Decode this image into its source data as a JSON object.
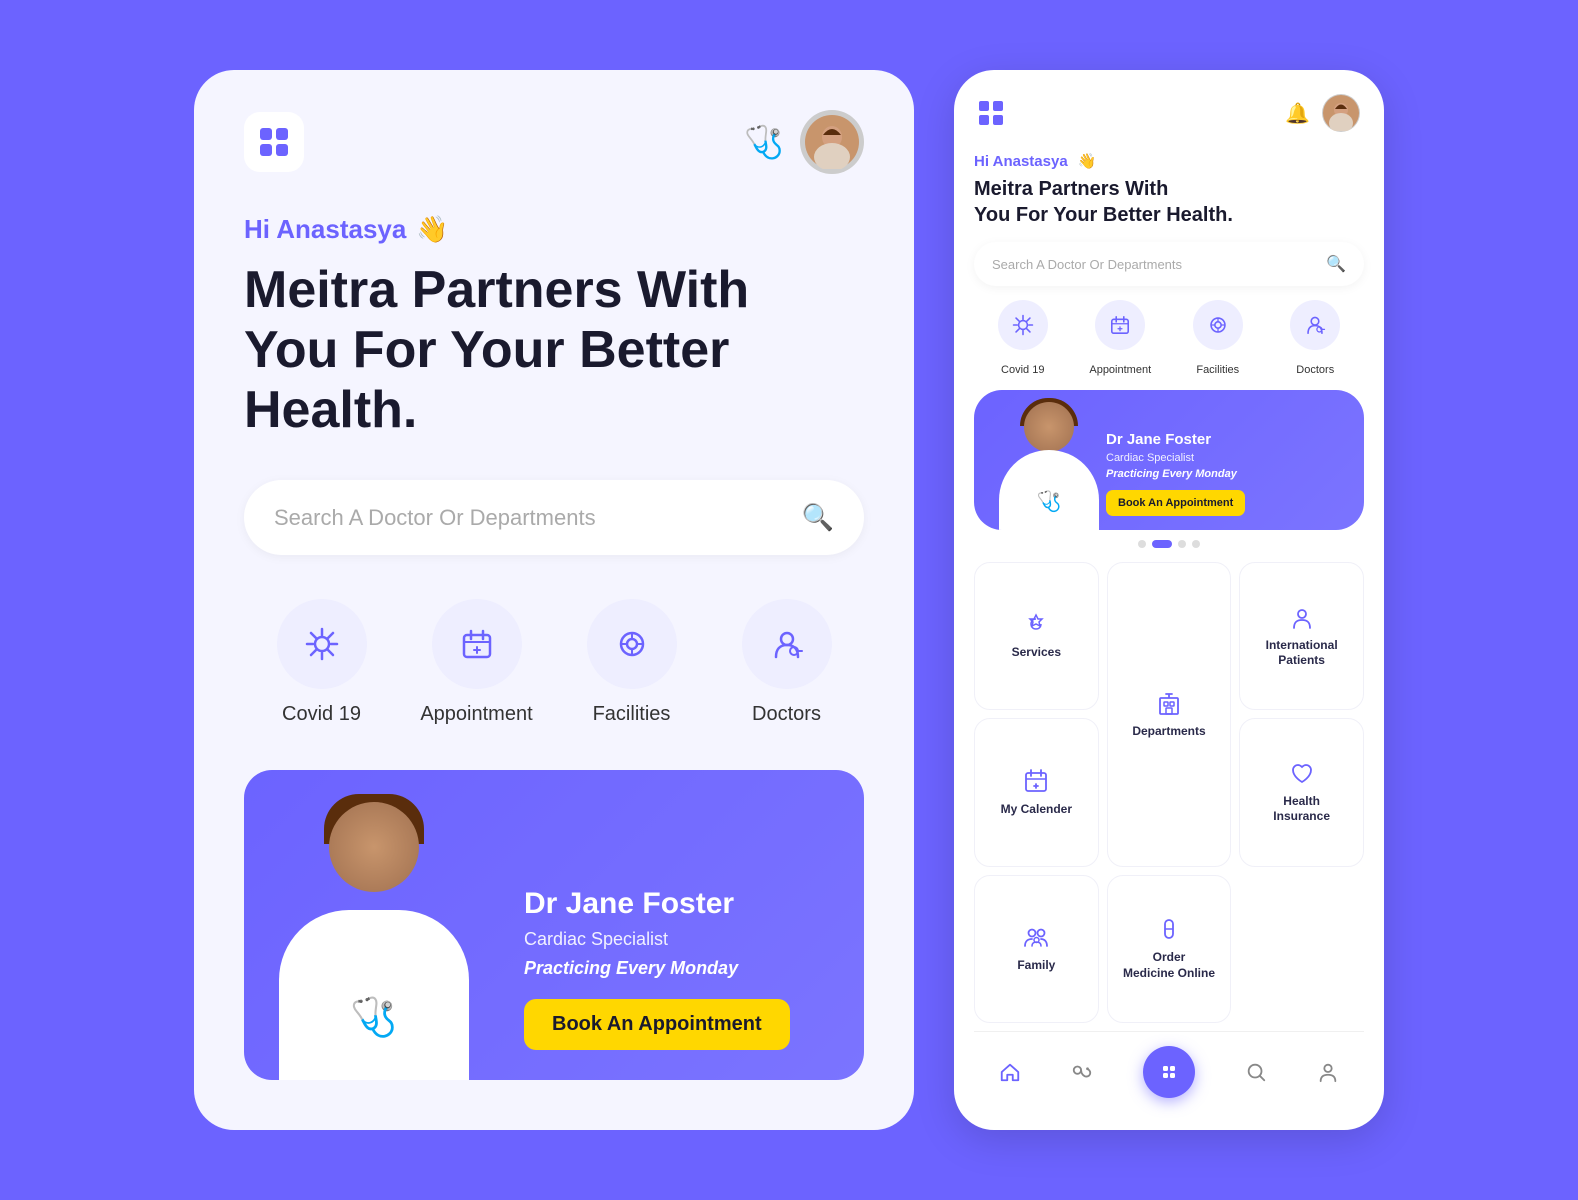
{
  "left_phone": {
    "greeting": "Hi Anastasya",
    "greeting_emoji": "👋",
    "hero_title": "Meitra Partners With\nYou For Your Better Health.",
    "search_placeholder": "Search A  Doctor Or Departments",
    "categories": [
      {
        "icon": "⚙️",
        "label": "Covid 19"
      },
      {
        "icon": "📋",
        "label": "Appointment"
      },
      {
        "icon": "🎯",
        "label": "Facilities"
      },
      {
        "icon": "🩺",
        "label": "Doctors"
      }
    ],
    "banner": {
      "doctor_name": "Dr Jane Foster",
      "specialty": "Cardiac Specialist",
      "schedule": "Practicing Every Monday",
      "book_btn": "Book An Appointment"
    }
  },
  "right_phone": {
    "greeting": "Hi Anastasya",
    "greeting_emoji": "👋",
    "hero_title": "Meitra Partners With\nYou For Your Better Health.",
    "search_placeholder": "Search A  Doctor Or Departments",
    "categories": [
      {
        "icon": "⚙️",
        "label": "Covid 19"
      },
      {
        "icon": "📋",
        "label": "Appointment"
      },
      {
        "icon": "🎯",
        "label": "Facilities"
      },
      {
        "icon": "🩺",
        "label": "Doctors"
      }
    ],
    "banner": {
      "doctor_name": "Dr Jane Foster",
      "specialty": "Cardiac Specialist",
      "schedule": "Practicing Every Monday",
      "book_btn": "Book An Appointment"
    },
    "services": [
      {
        "icon": "❤️",
        "label": "Services"
      },
      {
        "icon": "🏢",
        "label": "Departments"
      },
      {
        "icon": "👤",
        "label": "International\nPatients"
      },
      {
        "icon": "📅",
        "label": "My Calender"
      },
      {
        "icon": "❤️‍🩹",
        "label": "Health\nInsurance"
      },
      {
        "icon": "👨‍👩‍👧",
        "label": "Family"
      },
      {
        "icon": "💊",
        "label": "Order\nMedicine Online"
      }
    ],
    "nav": [
      {
        "icon": "🏠",
        "active": true
      },
      {
        "icon": "🩺",
        "active": false
      },
      {
        "icon": "🔍",
        "active": false
      },
      {
        "icon": "👤",
        "active": false
      }
    ]
  },
  "colors": {
    "primary": "#6C63FF",
    "accent": "#FFD700",
    "background": "#6C63FF",
    "card_bg": "#F5F5FF",
    "text_dark": "#1a1a2e",
    "text_light": "#888888"
  }
}
